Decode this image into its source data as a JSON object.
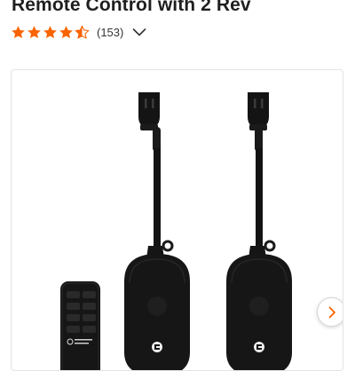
{
  "product": {
    "title": "Remote Control with 2 Rev",
    "rating": 4.5,
    "rating_max": 5,
    "rating_count_label": "(153)"
  },
  "icons": {
    "star": "star-icon",
    "expand": "chevron-down-icon",
    "next": "chevron-right-icon"
  },
  "colors": {
    "star_fill": "#f96302",
    "next_arrow": "#f96302",
    "product_body": "#161616"
  },
  "brand_logo_text": "Commercial Electric"
}
